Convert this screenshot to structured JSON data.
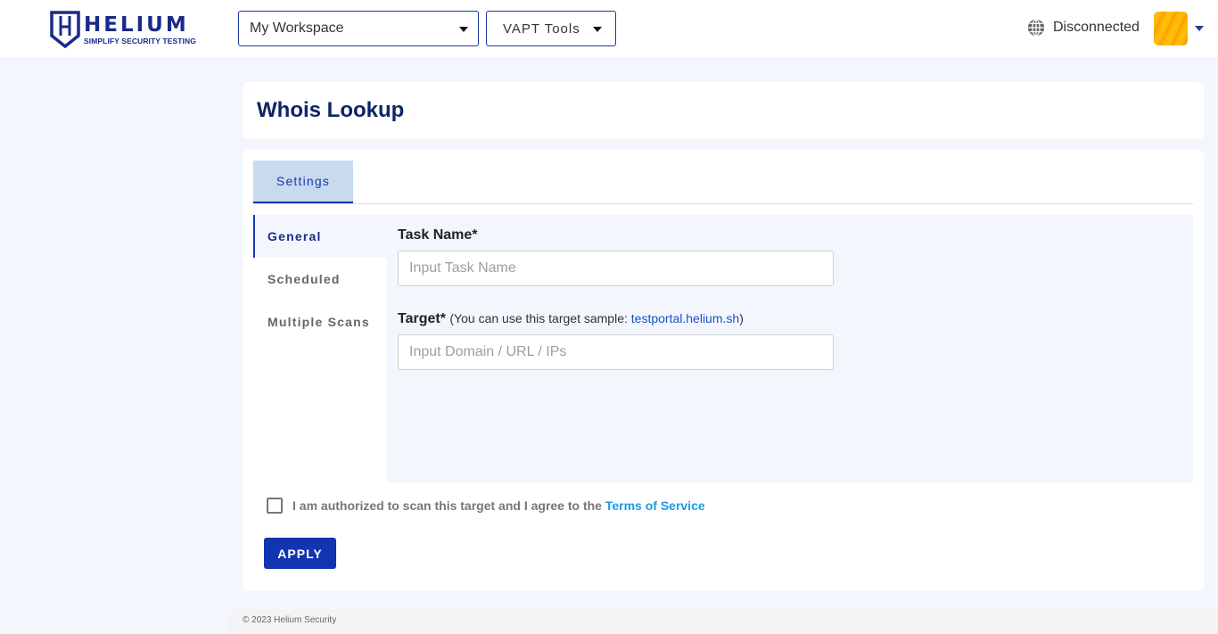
{
  "header": {
    "logo": {
      "word": "HELIUM",
      "tagline": "SIMPLIFY SECURITY TESTING"
    },
    "workspace_select": {
      "value": "My Workspace"
    },
    "tools_select": {
      "value": "VAPT Tools"
    },
    "connection": {
      "icon": "globe-icon",
      "status": "Disconnected"
    },
    "avatar": {
      "icon": "user-avatar"
    }
  },
  "page": {
    "title": "Whois Lookup"
  },
  "tabs": [
    {
      "label": "Settings",
      "active": true
    }
  ],
  "side_nav": [
    {
      "label": "General",
      "active": true
    },
    {
      "label": "Scheduled",
      "active": false
    },
    {
      "label": "Multiple Scans",
      "active": false
    }
  ],
  "form": {
    "task_name": {
      "label": "Task Name*",
      "placeholder": "Input Task Name",
      "value": ""
    },
    "target": {
      "label": "Target*",
      "hint_prefix": "(You can use this target sample: ",
      "hint_sample": "testportal.helium.sh",
      "hint_suffix": ")",
      "placeholder": "Input Domain / URL / IPs",
      "value": ""
    },
    "agreement": {
      "checked": false,
      "text": "I am authorized to scan this target and I agree to the ",
      "link": "Terms of Service"
    },
    "apply_label": "APPLY"
  },
  "colors": {
    "brand": "#1a2a8a",
    "primary_button": "#1234b0",
    "link": "#1a9be6",
    "page_bg": "#f3f7fd"
  },
  "footer": {
    "text": "© 2023 Helium Security"
  }
}
